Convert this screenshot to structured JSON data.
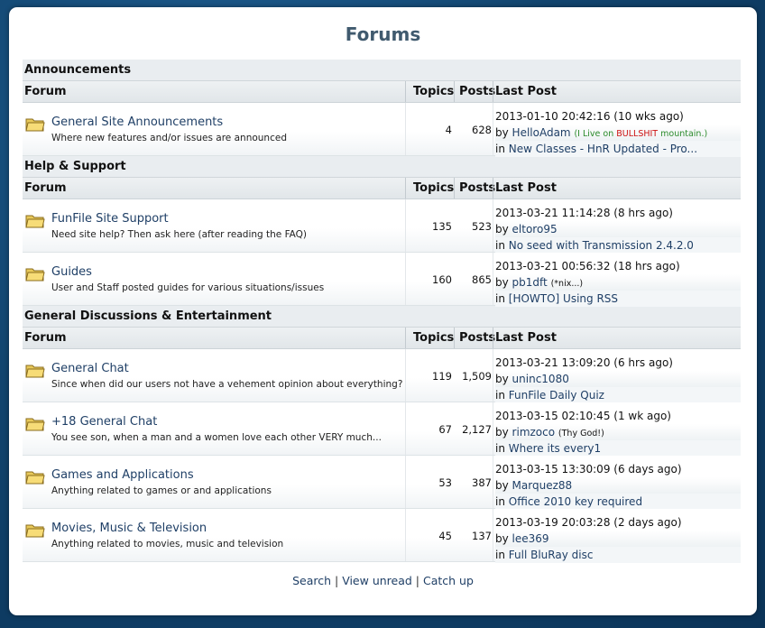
{
  "page": {
    "title": "Forums"
  },
  "columns": {
    "forum": "Forum",
    "topics": "Topics",
    "posts": "Posts",
    "last_post": "Last Post"
  },
  "sections": [
    {
      "name": "Announcements",
      "forums": [
        {
          "name": "General Site Announcements",
          "desc": "Where new features and/or issues are announced",
          "topics": "4",
          "posts": "628",
          "last_time": "2013-01-10 20:42:16 (10 wks ago)",
          "last_by": "by ",
          "last_user": "HelloAdam",
          "tag_pre": "(I Live on ",
          "tag_red": "BULLSHIT",
          "tag_post": " mountain.)",
          "last_in": "in ",
          "last_topic": "New Classes - HnR Updated - Pro..."
        }
      ]
    },
    {
      "name": "Help & Support",
      "forums": [
        {
          "name": "FunFile Site Support",
          "desc": "Need site help? Then ask here (after reading the FAQ)",
          "topics": "135",
          "posts": "523",
          "last_time": "2013-03-21 11:14:28 (8 hrs ago)",
          "last_by": "by ",
          "last_user": "eltoro95",
          "tag": "",
          "last_in": "in ",
          "last_topic": "No seed with Transmission 2.4.2.0"
        },
        {
          "name": "Guides",
          "desc": "User and Staff posted guides for various situations/issues",
          "topics": "160",
          "posts": "865",
          "last_time": "2013-03-21 00:56:32 (18 hrs ago)",
          "last_by": "by ",
          "last_user": "pb1dft",
          "tag": "(*nix...)",
          "last_in": "in ",
          "last_topic": "[HOWTO] Using RSS"
        }
      ]
    },
    {
      "name": "General Discussions & Entertainment",
      "forums": [
        {
          "name": "General Chat",
          "desc": "Since when did our users not have a vehement opinion about everything?",
          "topics": "119",
          "posts": "1,509",
          "last_time": "2013-03-21 13:09:20 (6 hrs ago)",
          "last_by": "by ",
          "last_user": "uninc1080",
          "tag": "",
          "last_in": "in ",
          "last_topic": "FunFile Daily Quiz"
        },
        {
          "name": "+18 General Chat",
          "desc": "You see son, when a man and a women love each other VERY much...",
          "topics": "67",
          "posts": "2,127",
          "last_time": "2013-03-15 02:10:45 (1 wk ago)",
          "last_by": "by ",
          "last_user": "rimzoco",
          "tag": "(Thy God!)",
          "last_in": "in ",
          "last_topic": "Where its every1"
        },
        {
          "name": "Games and Applications",
          "desc": "Anything related to games or and applications",
          "topics": "53",
          "posts": "387",
          "last_time": "2013-03-15 13:30:09 (6 days ago)",
          "last_by": "by ",
          "last_user": "Marquez88",
          "tag": "",
          "last_in": "in ",
          "last_topic": "Office 2010 key required"
        },
        {
          "name": "Movies, Music & Television",
          "desc": "Anything related to movies, music and television",
          "topics": "45",
          "posts": "137",
          "last_time": "2013-03-19 20:03:28 (2 days ago)",
          "last_by": "by ",
          "last_user": "lee369",
          "tag": "",
          "last_in": "in ",
          "last_topic": "Full BluRay disc"
        }
      ]
    }
  ],
  "footer": {
    "search": "Search",
    "sep": " | ",
    "view_unread": "View unread",
    "catch_up": "Catch up"
  },
  "colors": {
    "link": "#1f3f66",
    "accent_green": "#2a8a2a",
    "accent_red": "#cc1111"
  }
}
